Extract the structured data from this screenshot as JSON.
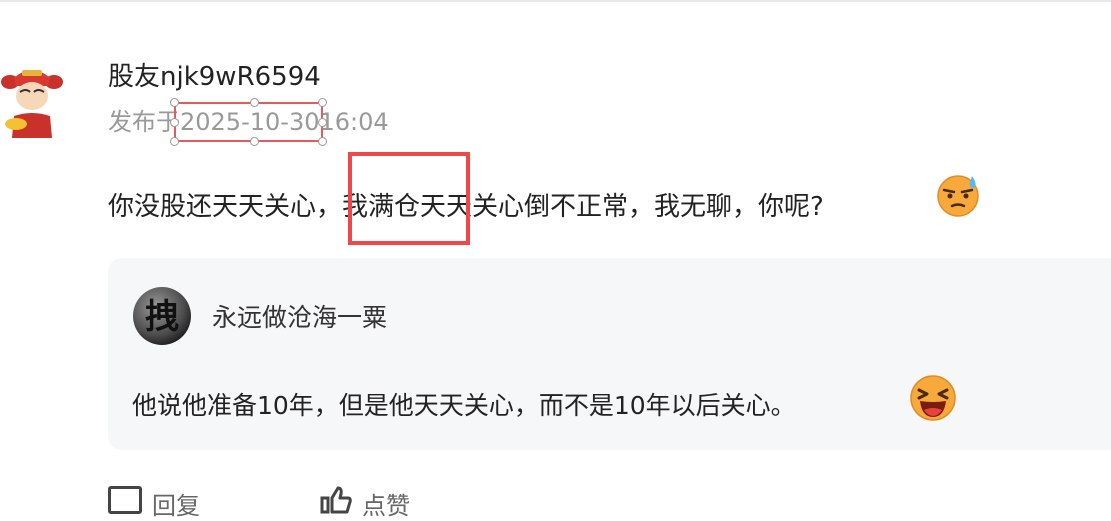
{
  "post": {
    "username": "股友njk9wR6594",
    "published_prefix": "发布于",
    "published_date": "2025-10-30",
    "published_time": "16:04",
    "comment_text": "你没股还天天关心，我满仓天天关心倒不正常，我无聊，你呢?",
    "comment_emoji": "sweat-emoji-icon"
  },
  "quote": {
    "avatar_char": "拽",
    "username": "永远做沧海一粟",
    "text": "他说他准备10年，但是他天天关心，而不是10年以后关心。",
    "emoji": "laughing-emoji-icon"
  },
  "actions": {
    "reply_label": "回复",
    "like_label": "点赞"
  },
  "colors": {
    "highlight_red": "#f04848",
    "meta_gray": "#999999",
    "card_bg": "#f6f7f9"
  }
}
